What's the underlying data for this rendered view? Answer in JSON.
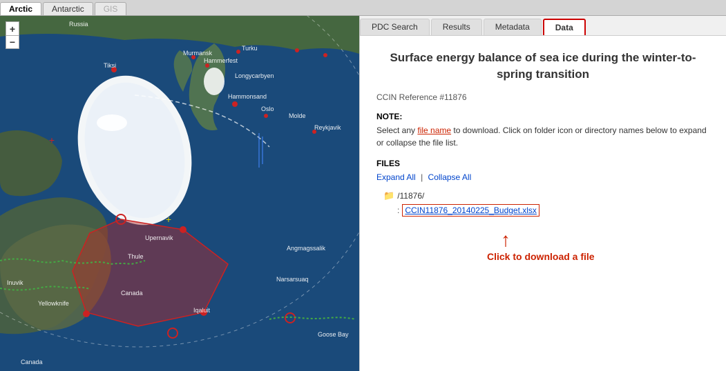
{
  "topNav": {
    "tabs": [
      {
        "id": "arctic",
        "label": "Arctic",
        "active": true,
        "disabled": false
      },
      {
        "id": "antarctic",
        "label": "Antarctic",
        "active": false,
        "disabled": false
      },
      {
        "id": "gis",
        "label": "GIS",
        "active": false,
        "disabled": false
      }
    ]
  },
  "rightTabs": [
    {
      "id": "pdc-search",
      "label": "PDC Search",
      "active": false
    },
    {
      "id": "results",
      "label": "Results",
      "active": false
    },
    {
      "id": "metadata",
      "label": "Metadata",
      "active": false
    },
    {
      "id": "data",
      "label": "Data",
      "active": true
    }
  ],
  "content": {
    "title": "Surface energy balance of sea ice during the winter-to-spring transition",
    "reference": "CCIN Reference #11876",
    "noteLabel": "NOTE:",
    "noteText1": "Select any file name to download. Click on folder icon or directory names below to expand or collapse the file list.",
    "filesLabel": "FILES",
    "expandAll": "Expand All",
    "separator": "|",
    "collapseAll": "Collapse All",
    "folder": "/11876/",
    "fileName": "CCIN11876_20140225_Budget.xlsx",
    "downloadHint": "Click to download a file"
  },
  "icons": {
    "plus": "+",
    "minus": "−",
    "folder": "📁",
    "arrowUp": "↑"
  }
}
